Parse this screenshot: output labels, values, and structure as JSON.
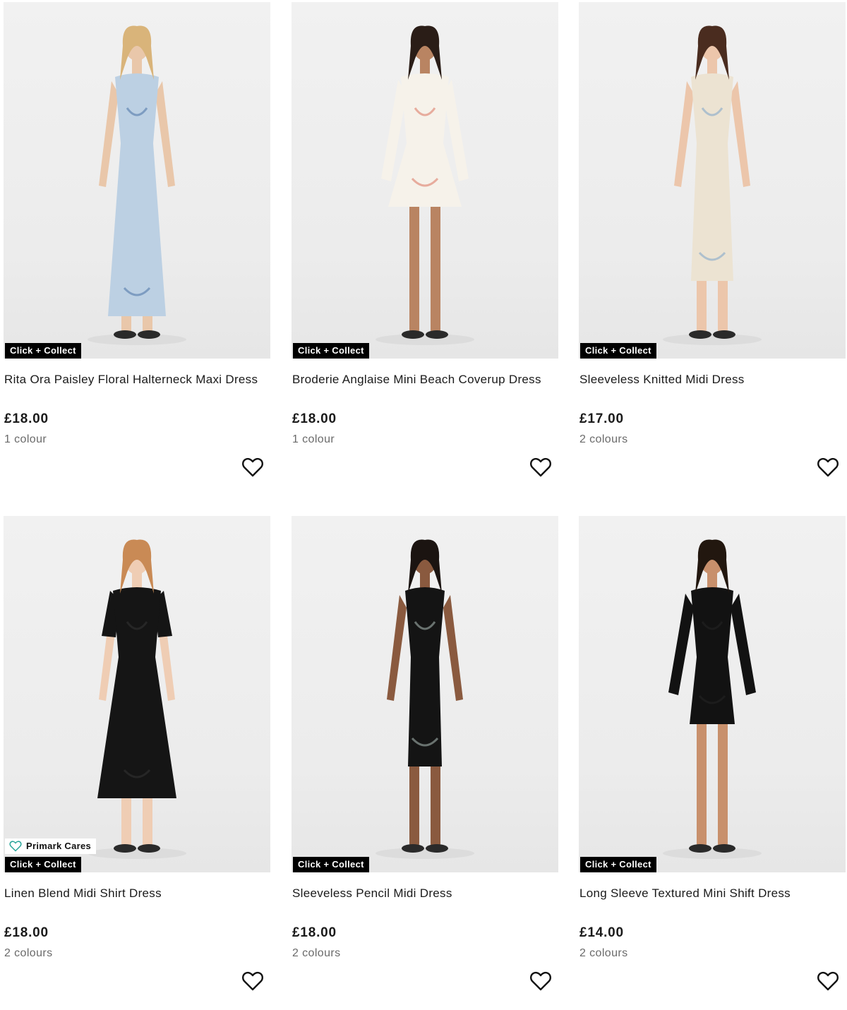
{
  "products": [
    {
      "title": "Rita Ora Paisley Floral Halterneck Maxi Dress",
      "price": "£18.00",
      "colours": "1 colour",
      "badges": [
        "Click + Collect"
      ],
      "colors": {
        "dress": "#bcd0e3",
        "accent": "#6d8fb8",
        "skin": "#e9c7aa",
        "hair": "#d9b47a"
      }
    },
    {
      "title": "Broderie Anglaise Mini Beach Coverup Dress",
      "price": "£18.00",
      "colours": "1 colour",
      "badges": [
        "Click + Collect"
      ],
      "colors": {
        "dress": "#f6f2ea",
        "accent": "#e49a8a",
        "skin": "#b98462",
        "hair": "#2a1d17"
      }
    },
    {
      "title": "Sleeveless Knitted Midi Dress",
      "price": "£17.00",
      "colours": "2 colours",
      "badges": [
        "Click + Collect"
      ],
      "colors": {
        "dress": "#ece3d2",
        "accent": "#9fb6cc",
        "skin": "#ecc6ab",
        "hair": "#4a2c1f"
      }
    },
    {
      "title": "Linen Blend Midi Shirt Dress",
      "price": "£18.00",
      "colours": "2 colours",
      "badges": [
        "Primark Cares",
        "Click + Collect"
      ],
      "colors": {
        "dress": "#151515",
        "accent": "#2a2a2a",
        "skin": "#efcdb4",
        "hair": "#c98a55"
      }
    },
    {
      "title": "Sleeveless Pencil Midi Dress",
      "price": "£18.00",
      "colours": "2 colours",
      "badges": [
        "Click + Collect"
      ],
      "colors": {
        "dress": "#141414",
        "accent": "#7e8a86",
        "skin": "#8a5a3f",
        "hair": "#1b1411"
      }
    },
    {
      "title": "Long Sleeve Textured Mini Shift Dress",
      "price": "£14.00",
      "colours": "2 colours",
      "badges": [
        "Click + Collect"
      ],
      "colors": {
        "dress": "#121212",
        "accent": "#1f1f1f",
        "skin": "#c8906c",
        "hair": "#22170f"
      }
    }
  ],
  "icons": {
    "wishlist": "heart-outline-icon",
    "cares": "heart-leaf-icon"
  },
  "colors": {
    "badge_bg": "#000000",
    "badge_text": "#ffffff",
    "cares_icon": "#2aa59a",
    "muted_text": "#6a6a6a"
  }
}
